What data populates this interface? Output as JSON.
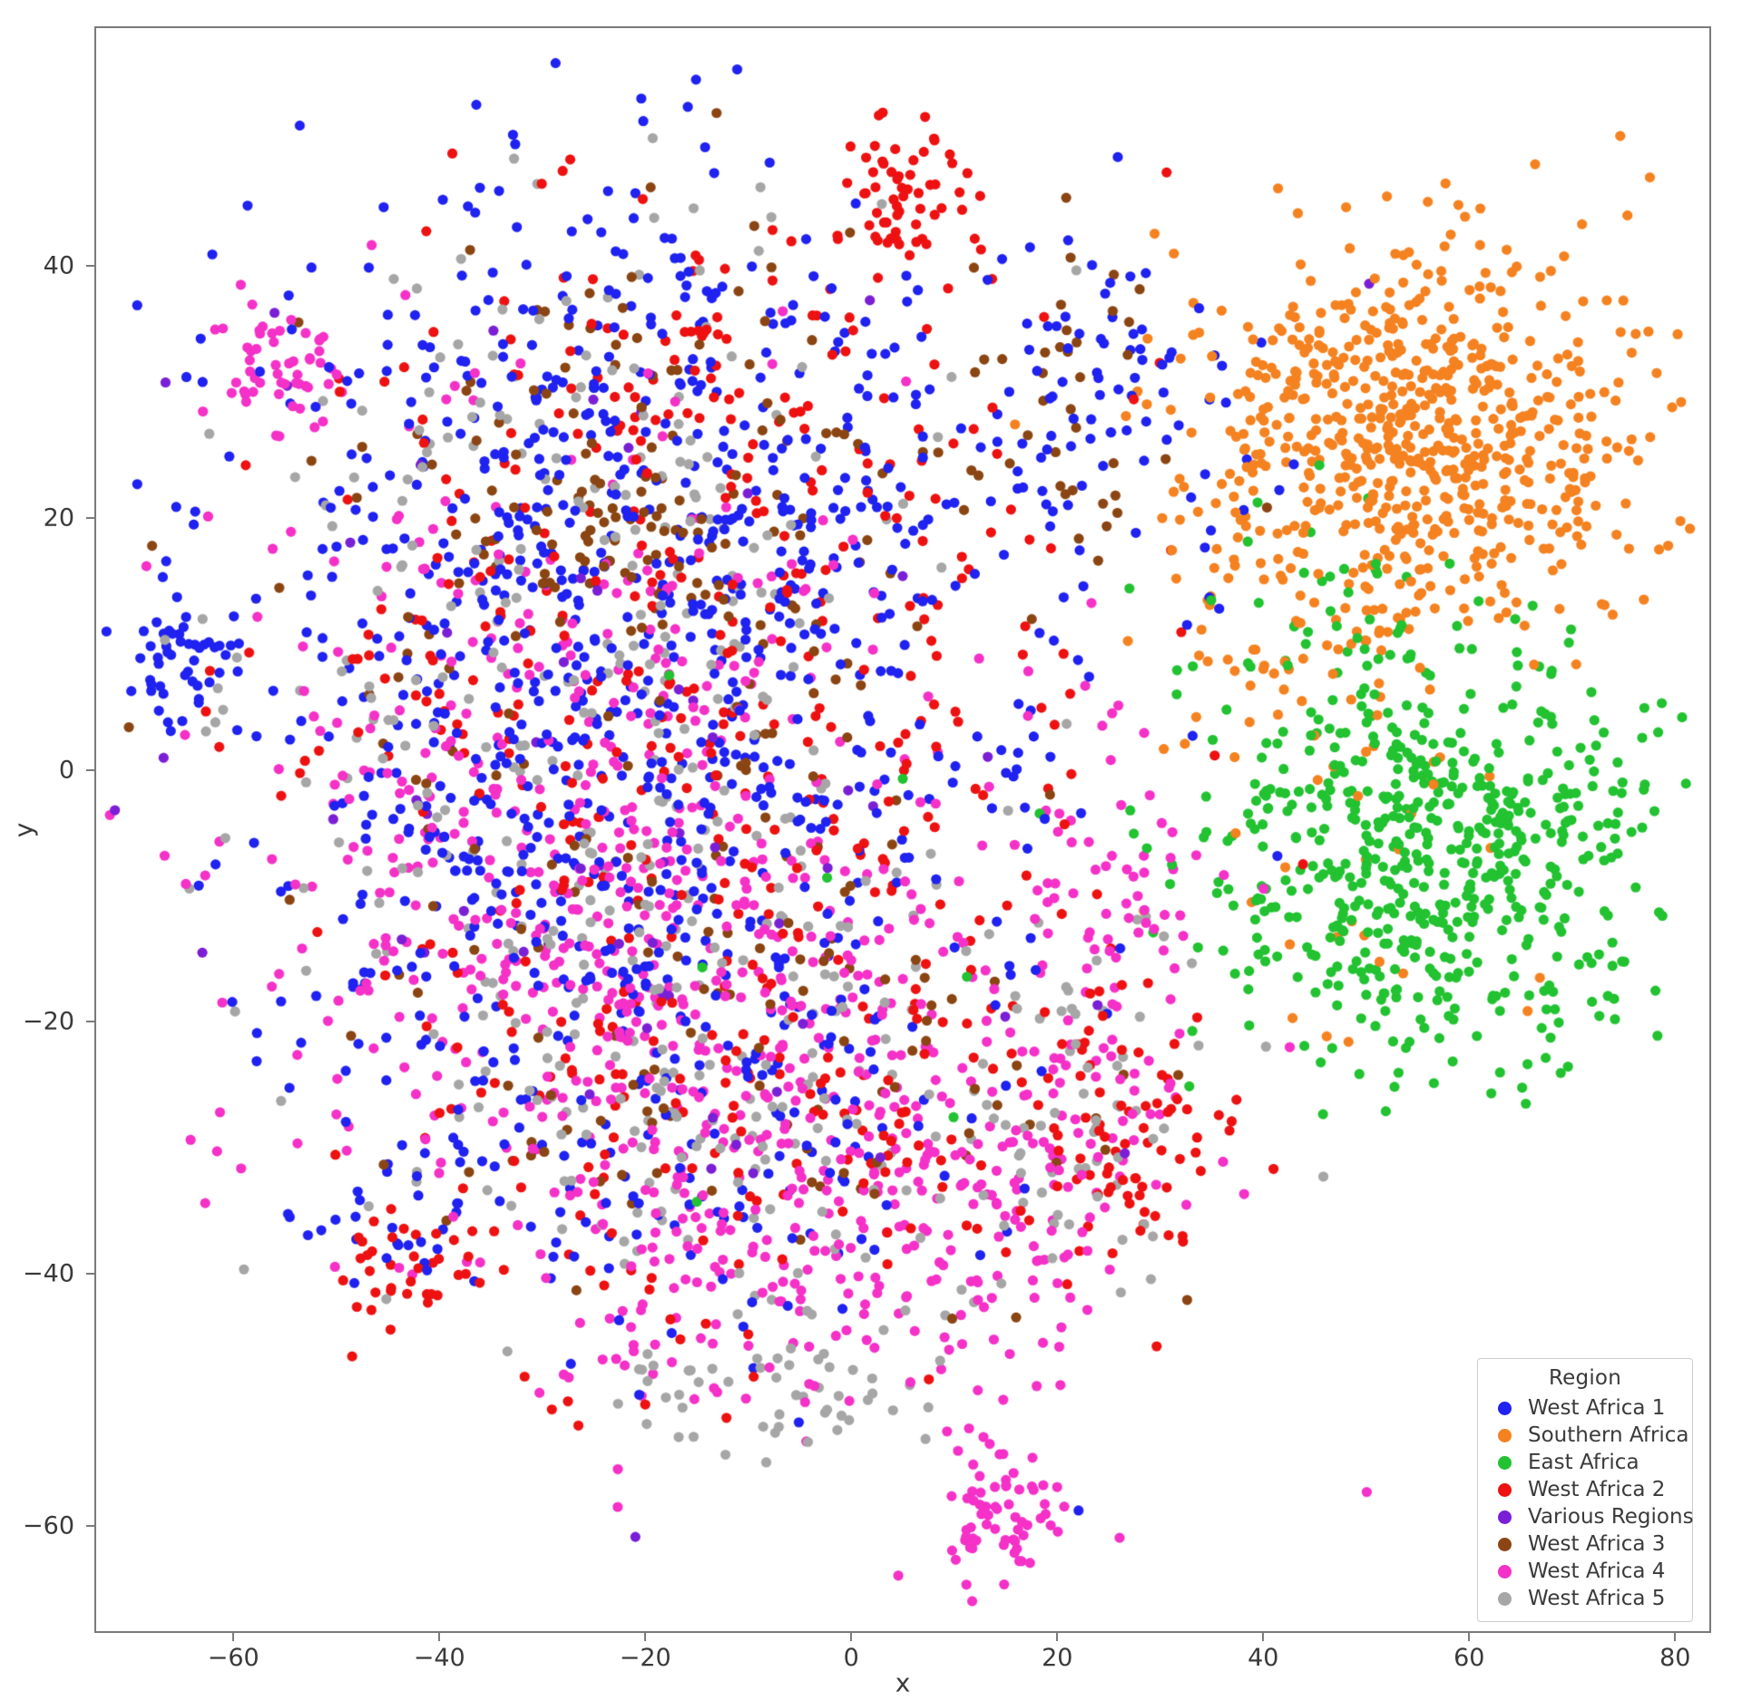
{
  "chart_data": {
    "type": "scatter",
    "title": "",
    "xlabel": "x",
    "ylabel": "y",
    "xlim": [
      -73.5,
      83.5
    ],
    "ylim": [
      -68.5,
      59.0
    ],
    "grid": false,
    "legend_position": "lower right",
    "legend_title": "Region",
    "xticks": [
      "-60",
      "-40",
      "-20",
      "0",
      "20",
      "40",
      "60",
      "80"
    ],
    "xtick_values": [
      -60,
      -40,
      -20,
      0,
      20,
      40,
      60,
      80
    ],
    "yticks": [
      "40",
      "20",
      "0",
      "-20",
      "-40",
      "-60"
    ],
    "ytick_values": [
      40,
      20,
      0,
      -20,
      -40,
      -60
    ],
    "marker": "circle",
    "marker_size": 11,
    "total_points": 5800,
    "series": [
      {
        "name": "West Africa 1",
        "color": "#1f22f0",
        "n": 1180,
        "clusters": [
          {
            "cx": -26,
            "cy": 30,
            "sx": 16,
            "sy": 11,
            "n": 250
          },
          {
            "cx": -12,
            "cy": 10,
            "sx": 20,
            "sy": 14,
            "n": 300
          },
          {
            "cx": -34,
            "cy": 2,
            "sx": 15,
            "sy": 15,
            "n": 230
          },
          {
            "cx": -18,
            "cy": -16,
            "sx": 18,
            "sy": 12,
            "n": 180
          },
          {
            "cx": -65,
            "cy": 9,
            "sx": 3,
            "sy": 3,
            "n": 45
          },
          {
            "cx": 22,
            "cy": 31,
            "sx": 5,
            "sy": 6,
            "n": 55
          },
          {
            "cx": -10,
            "cy": -34,
            "sx": 14,
            "sy": 8,
            "n": 70
          },
          {
            "cx": -44,
            "cy": -36,
            "sx": 4,
            "sy": 3,
            "n": 25
          },
          {
            "cx": 35,
            "cy": 24,
            "sx": 6,
            "sy": 9,
            "n": 25
          }
        ]
      },
      {
        "name": "Southern Africa",
        "color": "#f58220",
        "n": 760,
        "clusters": [
          {
            "cx": 55,
            "cy": 27,
            "sx": 11,
            "sy": 8,
            "n": 680
          },
          {
            "cx": 40,
            "cy": 14,
            "sx": 5,
            "sy": 8,
            "n": 45
          },
          {
            "cx": 48,
            "cy": -5,
            "sx": 9,
            "sy": 9,
            "n": 35
          }
        ]
      },
      {
        "name": "East Africa",
        "color": "#22c231",
        "n": 640,
        "clusters": [
          {
            "cx": 57,
            "cy": -7,
            "sx": 11,
            "sy": 8,
            "n": 590
          },
          {
            "cx": 50,
            "cy": 13,
            "sx": 7,
            "sy": 5,
            "n": 40
          },
          {
            "cx": 0,
            "cy": -12,
            "sx": 22,
            "sy": 16,
            "n": 10
          }
        ]
      },
      {
        "name": "West Africa 2",
        "color": "#ee1111",
        "n": 700,
        "clusters": [
          {
            "cx": -14,
            "cy": 24,
            "sx": 16,
            "sy": 12,
            "n": 180
          },
          {
            "cx": 5,
            "cy": 45,
            "sx": 3,
            "sy": 3,
            "n": 60
          },
          {
            "cx": -10,
            "cy": -1,
            "sx": 19,
            "sy": 13,
            "n": 160
          },
          {
            "cx": -8,
            "cy": -27,
            "sx": 18,
            "sy": 10,
            "n": 150
          },
          {
            "cx": 27,
            "cy": -31,
            "sx": 5,
            "sy": 6,
            "n": 70
          },
          {
            "cx": -42,
            "cy": -39,
            "sx": 4,
            "sy": 3,
            "n": 35
          },
          {
            "cx": -36,
            "cy": 7,
            "sx": 14,
            "sy": 14,
            "n": 45
          }
        ]
      },
      {
        "name": "Various Regions",
        "color": "#7b1fd6",
        "n": 60,
        "clusters": [
          {
            "cx": -20,
            "cy": 0,
            "sx": 22,
            "sy": 20,
            "n": 60
          }
        ]
      },
      {
        "name": "West Africa 3",
        "color": "#8b4513",
        "n": 330,
        "clusters": [
          {
            "cx": -20,
            "cy": 26,
            "sx": 16,
            "sy": 12,
            "n": 110
          },
          {
            "cx": 22,
            "cy": 30,
            "sx": 5,
            "sy": 6,
            "n": 35
          },
          {
            "cx": -16,
            "cy": 2,
            "sx": 20,
            "sy": 14,
            "n": 90
          },
          {
            "cx": -8,
            "cy": -26,
            "sx": 18,
            "sy": 10,
            "n": 70
          },
          {
            "cx": -23,
            "cy": 19,
            "sx": 3,
            "sy": 2,
            "n": 25
          }
        ]
      },
      {
        "name": "West Africa 4",
        "color": "#f531c8",
        "n": 1100,
        "clusters": [
          {
            "cx": -22,
            "cy": -14,
            "sx": 18,
            "sy": 13,
            "n": 300
          },
          {
            "cx": -5,
            "cy": -28,
            "sx": 17,
            "sy": 10,
            "n": 280
          },
          {
            "cx": -56,
            "cy": 32,
            "sx": 3,
            "sy": 3,
            "n": 55
          },
          {
            "cx": 14,
            "cy": -59,
            "sx": 3,
            "sy": 4,
            "n": 70
          },
          {
            "cx": -28,
            "cy": 8,
            "sx": 15,
            "sy": 14,
            "n": 180
          },
          {
            "cx": 26,
            "cy": -12,
            "sx": 5,
            "sy": 10,
            "n": 80
          },
          {
            "cx": -5,
            "cy": -43,
            "sx": 11,
            "sy": 5,
            "n": 75
          },
          {
            "cx": 17,
            "cy": -35,
            "sx": 6,
            "sy": 6,
            "n": 60
          }
        ]
      },
      {
        "name": "West Africa 5",
        "color": "#a6a6a6",
        "n": 520,
        "clusters": [
          {
            "cx": -28,
            "cy": 4,
            "sx": 17,
            "sy": 16,
            "n": 170
          },
          {
            "cx": -12,
            "cy": -22,
            "sx": 18,
            "sy": 12,
            "n": 170
          },
          {
            "cx": -8,
            "cy": -48,
            "sx": 7,
            "sy": 4,
            "n": 55
          },
          {
            "cx": -20,
            "cy": 28,
            "sx": 15,
            "sy": 10,
            "n": 70
          },
          {
            "cx": 22,
            "cy": -28,
            "sx": 7,
            "sy": 7,
            "n": 55
          }
        ]
      }
    ]
  },
  "axis": {
    "xlabel": "x",
    "ylabel": "y"
  },
  "legend": {
    "title": "Region",
    "items": [
      {
        "label": "West Africa 1",
        "color": "#1f22f0"
      },
      {
        "label": "Southern Africa",
        "color": "#f58220"
      },
      {
        "label": "East Africa",
        "color": "#22c231"
      },
      {
        "label": "West Africa 2",
        "color": "#ee1111"
      },
      {
        "label": "Various Regions",
        "color": "#7b1fd6"
      },
      {
        "label": "West Africa 3",
        "color": "#8b4513"
      },
      {
        "label": "West Africa 4",
        "color": "#f531c8"
      },
      {
        "label": "West Africa 5",
        "color": "#a6a6a6"
      }
    ]
  }
}
